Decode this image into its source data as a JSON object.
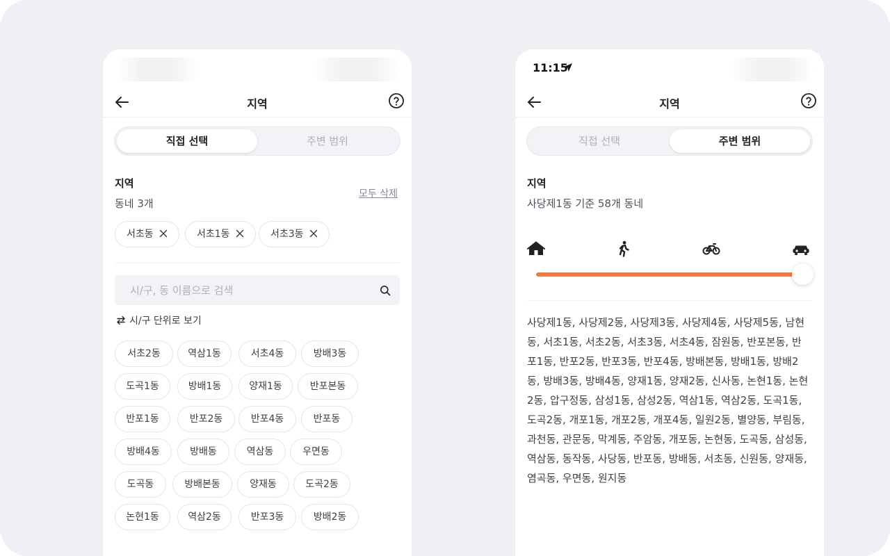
{
  "left": {
    "title": "지역",
    "tabs": {
      "direct": "직접 선택",
      "range": "주변 범위"
    },
    "region_label": "지역",
    "count_label": "동네 3개",
    "delete_all": "모두 삭제",
    "selected": [
      "서초동",
      "서초1동",
      "서초3동"
    ],
    "search_placeholder": "시/구, 동 이름으로 검색",
    "view_toggle": "시/구 단위로 보기",
    "suggestions": [
      "서초2동",
      "역삼1동",
      "서초4동",
      "방배3동",
      "도곡1동",
      "방배1동",
      "양재1동",
      "반포본동",
      "반포1동",
      "반포2동",
      "반포4동",
      "반포동",
      "방배4동",
      "방배동",
      "역삼동",
      "우면동",
      "도곡동",
      "방배본동",
      "양재동",
      "도곡2동",
      "논현1동",
      "역삼2동",
      "반포3동",
      "방배2동"
    ]
  },
  "right": {
    "status_time": "11:15",
    "title": "지역",
    "tabs": {
      "direct": "직접 선택",
      "range": "주변 범위"
    },
    "region_label": "지역",
    "basis_label": "사당제1동 기준 58개 동네",
    "range_icons": [
      "home-icon",
      "walk-icon",
      "bicycle-icon",
      "car-icon"
    ],
    "range_level": 1.0,
    "neighbors": "사당제1동, 사당제2동, 사당제3동, 사당제4동, 사당제5동, 남현동, 서초1동, 서초2동, 서초3동, 서초4동, 잠원동, 반포본동, 반포1동, 반포2동, 반포3동, 반포4동, 방배본동, 방배1동, 방배2동, 방배3동, 방배4동, 양재1동, 양재2동, 신사동, 논현1동, 논현2동, 압구정동, 삼성1동, 삼성2동, 역삼1동, 역삼2동, 도곡1동, 도곡2동, 개포1동, 개포2동, 개포4동, 일원2동, 별양동, 부림동, 과천동, 관문동, 막계동, 주암동, 개포동, 논현동, 도곡동, 삼성동, 역삼동, 동작동, 사당동, 반포동, 방배동, 서초동, 신원동, 양재동, 염곡동, 우면동, 원지동"
  },
  "colors": {
    "accent": "#f27b40",
    "background": "#eff0f4"
  }
}
